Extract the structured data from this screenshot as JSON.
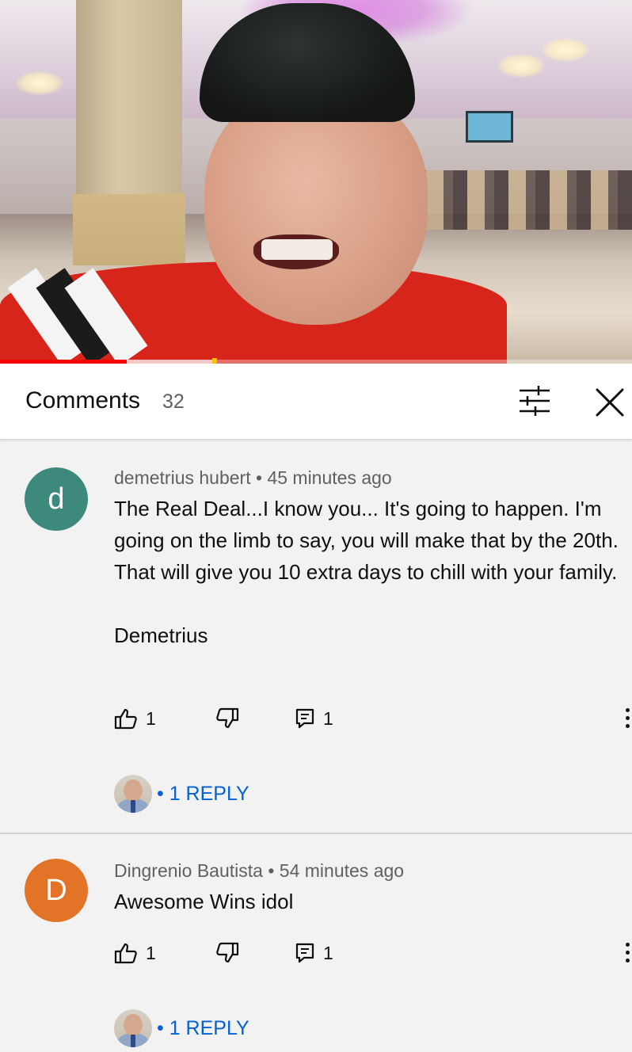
{
  "header": {
    "title": "Comments",
    "count": "32",
    "icons": {
      "filter": "sliders-icon",
      "close": "close-icon"
    }
  },
  "video": {
    "progress_played_fraction": 0.2,
    "progress_buffered_fraction": 0.34
  },
  "comments": [
    {
      "avatar_letter": "d",
      "avatar_color": "#3d8a7c",
      "author": "demetrius hubert",
      "separator": "•",
      "time": "45 minutes ago",
      "body": [
        "The Real Deal...I know you... It's going to happen. I'm going on the limb to say, you will make that by the 20th. That will give you 10 extra days to chill with your family.",
        "Demetrius"
      ],
      "likes": "1",
      "comments_count": "1",
      "reply_label": "• 1 REPLY"
    },
    {
      "avatar_letter": "D",
      "avatar_color": "#e37427",
      "author": "Dingrenio Bautista",
      "separator": "•",
      "time": "54 minutes ago",
      "body": [
        "Awesome Wins idol"
      ],
      "likes": "1",
      "comments_count": "1",
      "reply_label": "• 1 REPLY"
    }
  ],
  "colors": {
    "link": "#065fd4",
    "progress": "#ff0000"
  }
}
